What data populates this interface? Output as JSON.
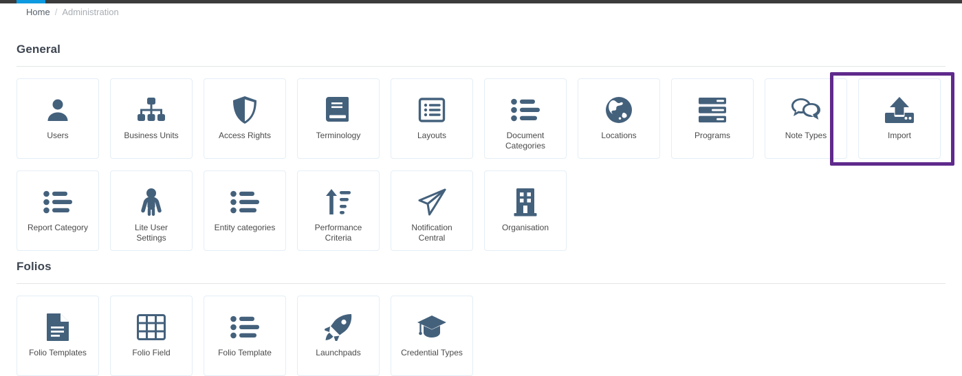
{
  "chrome": {
    "accent_color": "#0d9ae0",
    "bar_color": "#3c3c3c"
  },
  "breadcrumb": {
    "home_label": "Home",
    "separator": "/",
    "current_label": "Administration"
  },
  "highlight": {
    "color": "#5f2a8c",
    "target": "Import"
  },
  "sections": [
    {
      "title": "General",
      "rows": [
        [
          {
            "label": "Users",
            "icon": "user-icon"
          },
          {
            "label": "Business Units",
            "icon": "sitemap-icon"
          },
          {
            "label": "Access Rights",
            "icon": "shield-icon"
          },
          {
            "label": "Terminology",
            "icon": "book-icon"
          },
          {
            "label": "Layouts",
            "icon": "list-box-icon"
          },
          {
            "label": "Document\nCategories",
            "icon": "list-ul-icon"
          },
          {
            "label": "Locations",
            "icon": "globe-icon"
          },
          {
            "label": "Programs",
            "icon": "server-icon"
          },
          {
            "label": "Note Types",
            "icon": "comments-icon"
          },
          {
            "label": "Import",
            "icon": "upload-icon"
          }
        ],
        [
          {
            "label": "Report Category",
            "icon": "list-ul-icon"
          },
          {
            "label": "Lite User\nSettings",
            "icon": "child-icon"
          },
          {
            "label": "Entity categories",
            "icon": "list-ul-icon"
          },
          {
            "label": "Performance\nCriteria",
            "icon": "sort-amount-up-icon"
          },
          {
            "label": "Notification\nCentral",
            "icon": "paper-plane-icon"
          },
          {
            "label": "Organisation",
            "icon": "building-icon"
          }
        ]
      ]
    },
    {
      "title": "Folios",
      "rows": [
        [
          {
            "label": "Folio Templates",
            "icon": "file-lines-icon"
          },
          {
            "label": "Folio Field",
            "icon": "table-icon"
          },
          {
            "label": "Folio Template",
            "icon": "list-ul-icon"
          },
          {
            "label": "Launchpads",
            "icon": "rocket-icon"
          },
          {
            "label": "Credential Types",
            "icon": "graduation-cap-icon"
          }
        ]
      ]
    }
  ]
}
